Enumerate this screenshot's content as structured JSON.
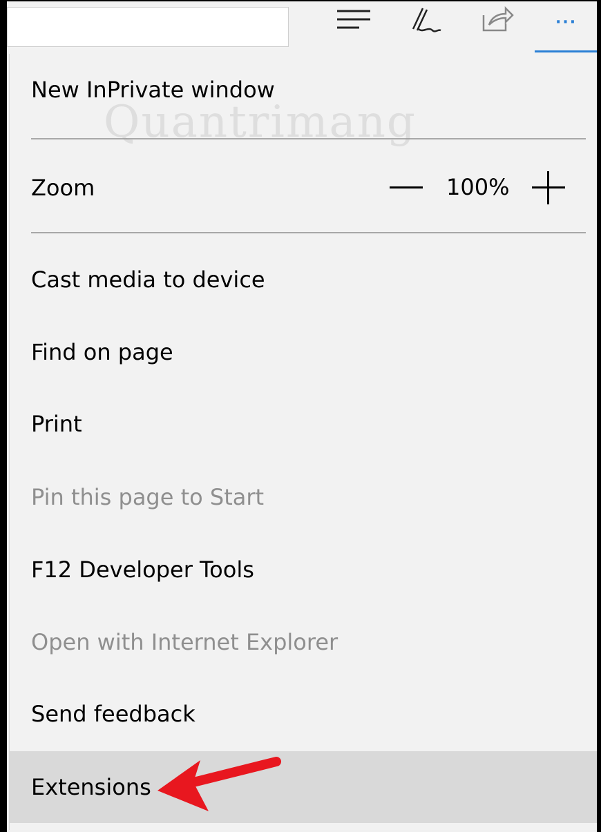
{
  "toolbar": {
    "icons": [
      "hub-icon",
      "web-note-icon",
      "share-icon",
      "more-icon"
    ],
    "more_label": "···",
    "accent_color": "#2a7fd5"
  },
  "menu": {
    "new_inprivate": "New InPrivate window",
    "zoom": {
      "label": "Zoom",
      "value": "100%"
    },
    "items": [
      {
        "label": "Cast media to device",
        "enabled": true
      },
      {
        "label": "Find on page",
        "enabled": true
      },
      {
        "label": "Print",
        "enabled": true
      },
      {
        "label": "Pin this page to Start",
        "enabled": false
      },
      {
        "label": "F12 Developer Tools",
        "enabled": true
      },
      {
        "label": "Open with Internet Explorer",
        "enabled": false
      },
      {
        "label": "Send feedback",
        "enabled": true
      },
      {
        "label": "Extensions",
        "enabled": true,
        "highlighted": true
      }
    ]
  },
  "watermark": "Quantrimang",
  "annotation_color": "#e8171f"
}
